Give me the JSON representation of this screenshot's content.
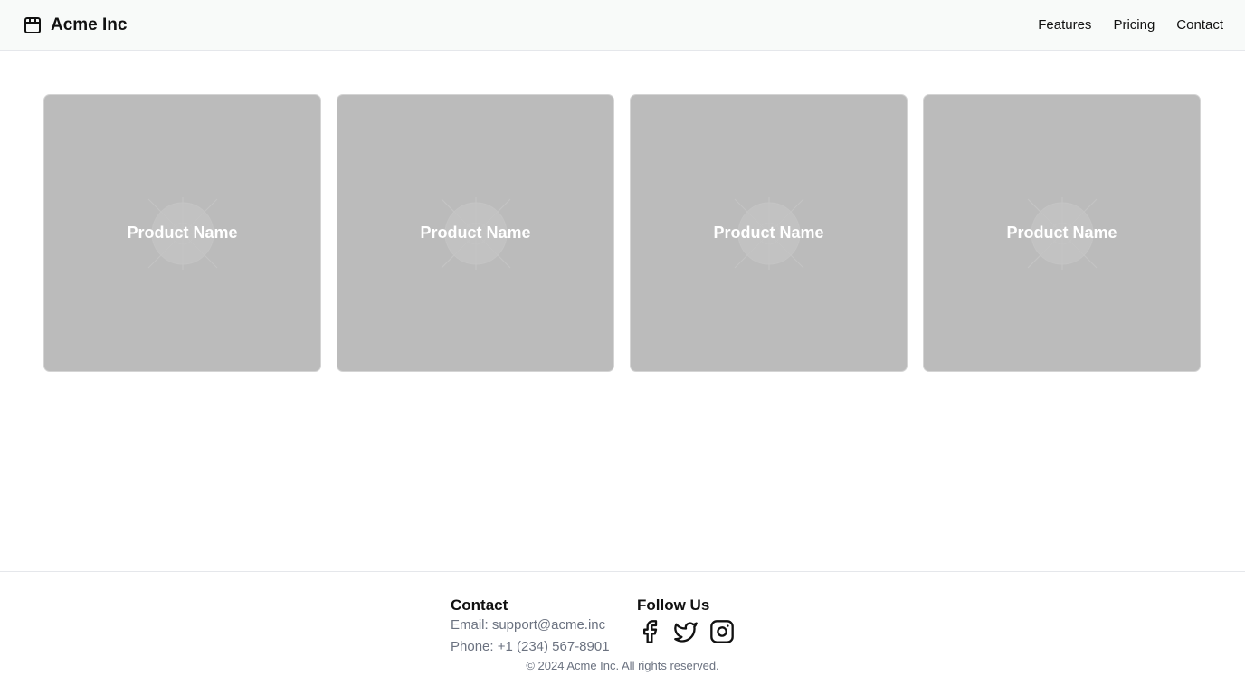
{
  "header": {
    "brand_name": "Acme Inc",
    "brand_icon": "package-icon",
    "nav": [
      {
        "label": "Features"
      },
      {
        "label": "Pricing"
      },
      {
        "label": "Contact"
      }
    ]
  },
  "products": [
    {
      "name": "Product Name",
      "image": "placeholder-image"
    },
    {
      "name": "Product Name",
      "image": "placeholder-image"
    },
    {
      "name": "Product Name",
      "image": "placeholder-image"
    },
    {
      "name": "Product Name",
      "image": "placeholder-image"
    }
  ],
  "footer": {
    "contact_heading": "Contact",
    "email": "Email: support@acme.inc",
    "phone": "Phone: +1 (234) 567-8901",
    "follow_heading": "Follow Us",
    "social": [
      "facebook-icon",
      "twitter-icon",
      "instagram-icon"
    ],
    "copyright": "© 2024 Acme Inc. All rights reserved."
  },
  "colors": {
    "card_background": "#bbbbbb",
    "header_background": "#f8faf9",
    "muted_text": "#6b7280"
  }
}
